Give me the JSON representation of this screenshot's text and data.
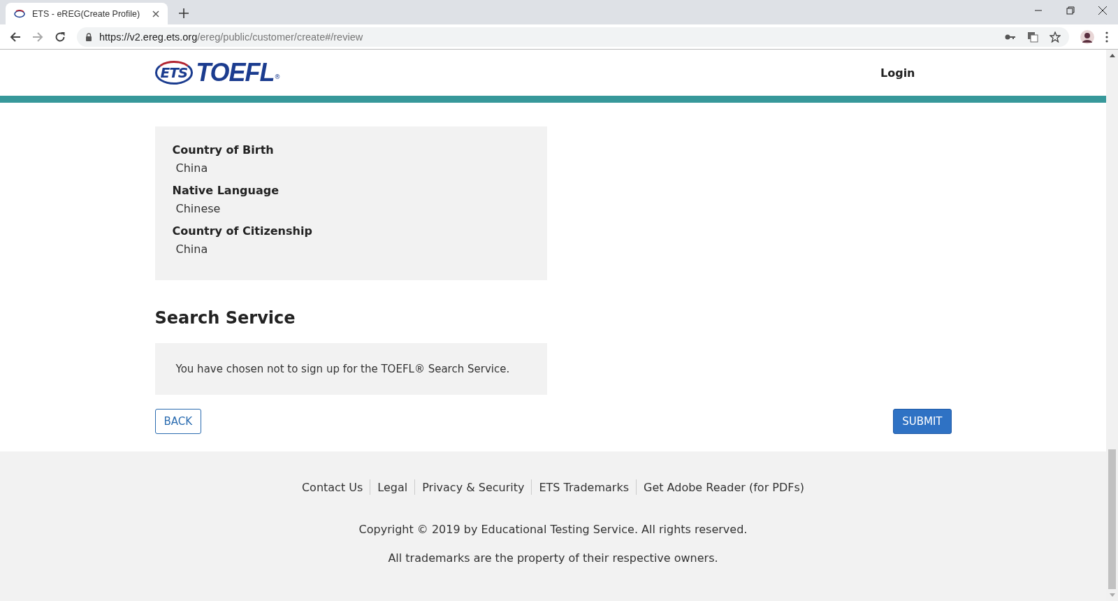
{
  "browser": {
    "tab": {
      "title": "ETS - eREG(Create Profile)",
      "selected": true
    },
    "url_host": "https://v2.ereg.ets.org",
    "url_path": "/ereg/public/customer/create#/review"
  },
  "header": {
    "logo_mark": "ETS",
    "logo_text": "TOEFL",
    "logo_reg": "®",
    "login": "Login"
  },
  "sections": [
    {
      "kind": "fields",
      "fields": [
        {
          "label": "Country of Birth",
          "value": "China"
        },
        {
          "label": "Native Language",
          "value": "Chinese"
        },
        {
          "label": "Country of Citizenship",
          "value": "China"
        }
      ]
    },
    {
      "heading": "Search Service",
      "kind": "text",
      "text": "You have chosen not to sign up for the TOEFL® Search Service."
    }
  ],
  "buttons": {
    "back": "BACK",
    "submit": "SUBMIT"
  },
  "footer": {
    "links": [
      "Contact Us",
      "Legal",
      "Privacy & Security",
      "ETS Trademarks",
      "Get Adobe Reader (for PDFs)"
    ],
    "copyright": "Copyright © 2019 by Educational Testing Service. All rights reserved.",
    "trademarks": "All trademarks are the property of their respective owners."
  }
}
